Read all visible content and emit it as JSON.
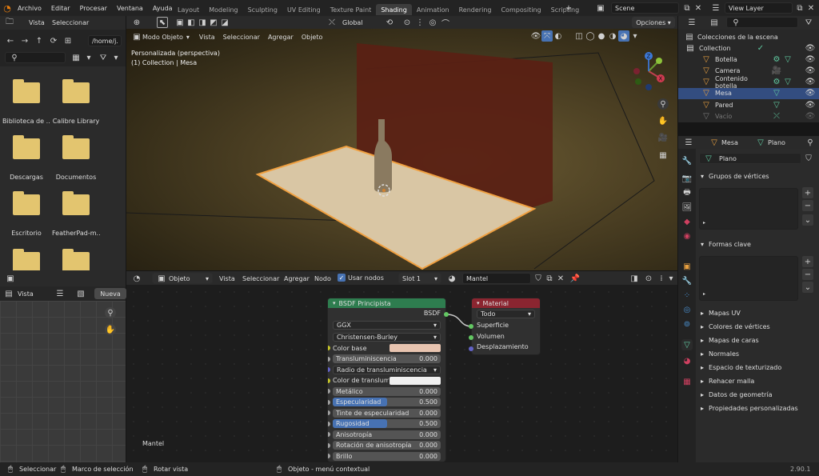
{
  "menu": [
    "Archivo",
    "Editar",
    "Procesar",
    "Ventana",
    "Ayuda"
  ],
  "workspaces": [
    {
      "label": "Layout",
      "active": false
    },
    {
      "label": "Modeling",
      "active": false
    },
    {
      "label": "Sculpting",
      "active": false
    },
    {
      "label": "UV Editing",
      "active": false
    },
    {
      "label": "Texture Paint",
      "active": false
    },
    {
      "label": "Shading",
      "active": true
    },
    {
      "label": "Animation",
      "active": false
    },
    {
      "label": "Rendering",
      "active": false
    },
    {
      "label": "Compositing",
      "active": false
    },
    {
      "label": "Scripting",
      "active": false
    }
  ],
  "scene": "Scene",
  "view_layer": "View Layer",
  "filebrowser": {
    "menu": [
      "Vista",
      "Seleccionar"
    ],
    "path": "/home/j...",
    "folders": [
      "Biblioteca de ...",
      "Calibre Library",
      "Descargas",
      "Documentos",
      "Escritorio",
      "FeatherPad-m...",
      "",
      ""
    ]
  },
  "viewport": {
    "mode": "Modo Objeto",
    "menu": [
      "Vista",
      "Seleccionar",
      "Agregar",
      "Objeto"
    ],
    "orientation": "Global",
    "options": "Opciones",
    "info_line1": "Personalizada (perspectiva)",
    "info_line2": "(1) Collection | Mesa",
    "gizmo": {
      "x": "X",
      "y": "Y",
      "z": "Z"
    }
  },
  "outliner": {
    "view_layer": "View Layer",
    "scene_collection": "Colecciones de la escena",
    "items": [
      {
        "name": "Collection"
      },
      {
        "name": "Botella"
      },
      {
        "name": "Camera"
      },
      {
        "name": "Contenido botella"
      },
      {
        "name": "Mesa"
      },
      {
        "name": "Pared"
      },
      {
        "name": "Vacío"
      }
    ]
  },
  "imageeditor": {
    "view": "Vista",
    "new": "Nueva"
  },
  "nodeeditor": {
    "type": "Objeto",
    "menu": [
      "Vista",
      "Seleccionar",
      "Agregar",
      "Nodo"
    ],
    "use_nodes": "Usar nodos",
    "slot": "Slot 1",
    "material": "Mantel",
    "footer_label": "Mantel"
  },
  "bsdf": {
    "title": "BSDF Principista",
    "output": "BSDF",
    "distribution": "GGX",
    "subsurface_method": "Christensen-Burley",
    "rows": [
      {
        "label": "Color base",
        "kind": "color",
        "color": "#e8c4b0"
      },
      {
        "label": "Transluminiscencia",
        "value": "0.000",
        "fill": 0
      },
      {
        "label": "Radio de transluminiscencia",
        "kind": "dropdown"
      },
      {
        "label": "Color de transluminiscencia",
        "kind": "color",
        "color": "#f0f0f0"
      },
      {
        "label": "Metálico",
        "value": "0.000",
        "fill": 0
      },
      {
        "label": "Especularidad",
        "value": "0.500",
        "fill": 0.5
      },
      {
        "label": "Tinte de especularidad",
        "value": "0.000",
        "fill": 0
      },
      {
        "label": "Rugosidad",
        "value": "0.500",
        "fill": 0.5
      },
      {
        "label": "Anisotropía",
        "value": "0.000",
        "fill": 0
      },
      {
        "label": "Rotación de anisotropía",
        "value": "0.000",
        "fill": 0
      },
      {
        "label": "Brillo",
        "value": "0.000",
        "fill": 0
      }
    ]
  },
  "material_out": {
    "title": "Material",
    "target": "Todo",
    "inputs": [
      "Superficie",
      "Volumen",
      "Desplazamiento"
    ]
  },
  "properties": {
    "object": "Mesa",
    "data": "Plano",
    "data_field": "Plano",
    "panels_open": [
      "Grupos de vértices",
      "Formas clave"
    ],
    "panels_closed": [
      "Mapas UV",
      "Colores de vértices",
      "Mapas de caras",
      "Normales",
      "Espacio de texturizado",
      "Rehacer malla",
      "Datos de geometría",
      "Propiedades personalizadas"
    ]
  },
  "statusbar": {
    "select": "Seleccionar",
    "box": "Marco de selección",
    "rotate": "Rotar vista",
    "context": "Objeto - menú contextual",
    "version": "2.90.1"
  },
  "colors": {
    "accent": "#4772b3",
    "selection": "#334d80",
    "bsdf_header": "#2e7d4f",
    "material_header": "#8b2530",
    "object_orange": "#e8a040",
    "mesh_green": "#60c9a0"
  }
}
